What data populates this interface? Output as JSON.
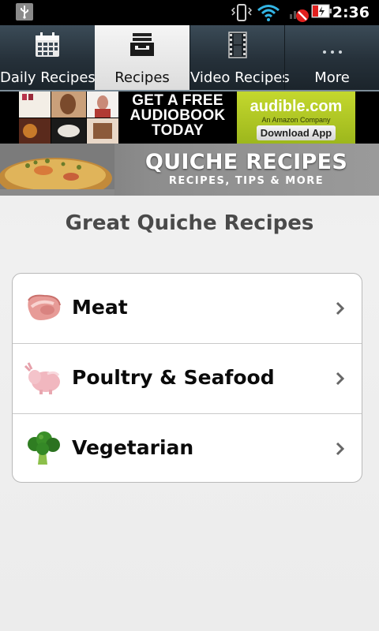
{
  "status_bar": {
    "time": "2:36",
    "icons": [
      "usb-icon",
      "vibrate-icon",
      "wifi-icon",
      "no-signal-icon",
      "battery-charging-icon"
    ]
  },
  "tabs": [
    {
      "label": "Daily Recipes",
      "icon": "calendar-icon",
      "active": false
    },
    {
      "label": "Recipes",
      "icon": "inbox-tray-icon",
      "active": true
    },
    {
      "label": "Video Recipes",
      "icon": "film-strip-icon",
      "active": false
    },
    {
      "label": "More",
      "icon": "more-dots-icon",
      "active": false
    }
  ],
  "ad": {
    "promo_lines": [
      "GET A FREE",
      "AUDIOBOOK",
      "TODAY"
    ],
    "brand": "audible.com",
    "sub": "An Amazon Company",
    "cta": "Download App"
  },
  "hero": {
    "title": "QUICHE RECIPES",
    "subtitle": "RECIPES, TIPS & MORE"
  },
  "heading": "Great Quiche Recipes",
  "categories": [
    {
      "label": "Meat",
      "icon": "meat-icon"
    },
    {
      "label": "Poultry & Seafood",
      "icon": "poultry-icon"
    },
    {
      "label": "Vegetarian",
      "icon": "broccoli-icon"
    }
  ],
  "colors": {
    "tab_bar": "#253039",
    "active_tab": "#e6e6e6",
    "ad_green": "#a9c222",
    "heading": "#4a4a4a"
  }
}
